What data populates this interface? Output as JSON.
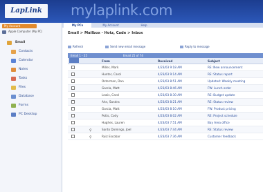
{
  "header": {
    "logo": "LapLink",
    "brand_url": "mylaplink.com"
  },
  "sidebar": {
    "top_button": "My Account",
    "device": "Apple Computer (My PC)",
    "items": [
      {
        "label": "Email",
        "icon": "email-icon",
        "color": "#e0a43a"
      },
      {
        "label": "Contacts",
        "icon": "contacts-icon",
        "color": "#e5a24b"
      },
      {
        "label": "Calendar",
        "icon": "calendar-icon",
        "color": "#5b84d6"
      },
      {
        "label": "Notes",
        "icon": "notes-icon",
        "color": "#e08e3c"
      },
      {
        "label": "Tasks",
        "icon": "tasks-icon",
        "color": "#d86a52"
      },
      {
        "label": "Files",
        "icon": "files-icon",
        "color": "#e2bb4a"
      },
      {
        "label": "Database",
        "icon": "database-icon",
        "color": "#6b8fd0"
      },
      {
        "label": "Forms",
        "icon": "forms-icon",
        "color": "#8fb14f"
      },
      {
        "label": "PC Desktop",
        "icon": "desktop-icon",
        "color": "#5b7ec4"
      }
    ]
  },
  "tabs": [
    "My PCs",
    "My Account",
    "Help"
  ],
  "breadcrumb": "Email > Mailbox - Hotz, Cade > Inbox",
  "toolbar": {
    "refresh": "Refresh",
    "send": "Send new email message",
    "reply": "Reply to message"
  },
  "grid": {
    "range": "Email 1 - 25",
    "total": "Email 25 of 74",
    "columns": {
      "from": "From",
      "received": "Received",
      "subject": "Subject"
    },
    "rows": [
      {
        "attach": false,
        "from": "Miller, Mark",
        "received": "4/23/03 9:18 AM",
        "subject": "RE: New announcement"
      },
      {
        "attach": false,
        "from": "Hunter, Carol",
        "received": "4/23/03 9:14 AM",
        "subject": "RE: Status report"
      },
      {
        "attach": false,
        "from": "Osterman, Dan",
        "received": "4/23/03 8:51 AM",
        "subject": "Updated: Weekly meeting"
      },
      {
        "attach": false,
        "from": "Garcia, Matt",
        "received": "4/23/03 8:46 AM",
        "subject": "FW: Lunch order"
      },
      {
        "attach": false,
        "from": "Lewis, Carol",
        "received": "4/23/03 8:30 AM",
        "subject": "RE: Budget update"
      },
      {
        "attach": false,
        "from": "Ahn, Sandra",
        "received": "4/23/03 8:21 AM",
        "subject": "RE: Status review"
      },
      {
        "attach": false,
        "from": "Garcia, Matt",
        "received": "4/23/03 8:10 AM",
        "subject": "FW: Product pricing"
      },
      {
        "attach": false,
        "from": "Potts, Cody",
        "received": "4/23/03 8:02 AM",
        "subject": "RE: Project schedule"
      },
      {
        "attach": false,
        "from": "Hughes, Lauren",
        "received": "4/23/03 7:51 AM",
        "subject": "Bay Area office"
      },
      {
        "attach": true,
        "from": "Santo Domingo, Joel",
        "received": "4/23/03 7:44 AM",
        "subject": "RE: Status review"
      },
      {
        "attach": true,
        "from": "Ruiz Escobar",
        "received": "4/23/03 7:36 AM",
        "subject": "Customer feedback"
      }
    ]
  }
}
